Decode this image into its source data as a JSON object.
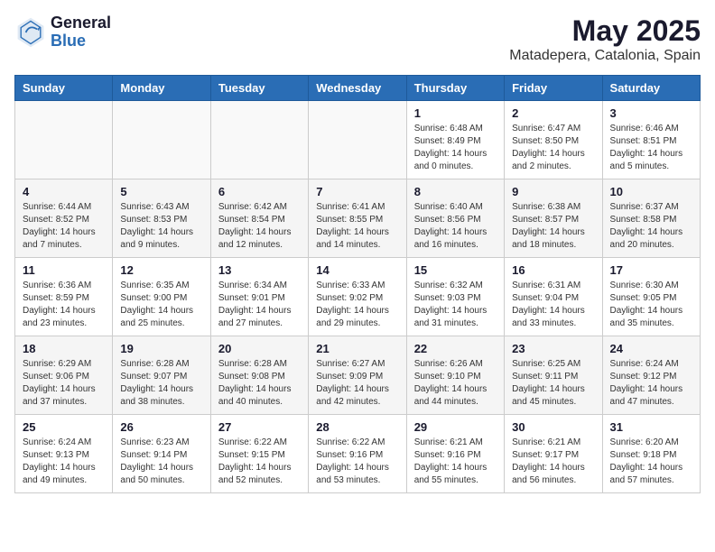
{
  "logo": {
    "general": "General",
    "blue": "Blue"
  },
  "title": "May 2025",
  "subtitle": "Matadepera, Catalonia, Spain",
  "days_header": [
    "Sunday",
    "Monday",
    "Tuesday",
    "Wednesday",
    "Thursday",
    "Friday",
    "Saturday"
  ],
  "weeks": [
    [
      {
        "day": "",
        "info": ""
      },
      {
        "day": "",
        "info": ""
      },
      {
        "day": "",
        "info": ""
      },
      {
        "day": "",
        "info": ""
      },
      {
        "day": "1",
        "info": "Sunrise: 6:48 AM\nSunset: 8:49 PM\nDaylight: 14 hours and 0 minutes."
      },
      {
        "day": "2",
        "info": "Sunrise: 6:47 AM\nSunset: 8:50 PM\nDaylight: 14 hours and 2 minutes."
      },
      {
        "day": "3",
        "info": "Sunrise: 6:46 AM\nSunset: 8:51 PM\nDaylight: 14 hours and 5 minutes."
      }
    ],
    [
      {
        "day": "4",
        "info": "Sunrise: 6:44 AM\nSunset: 8:52 PM\nDaylight: 14 hours and 7 minutes."
      },
      {
        "day": "5",
        "info": "Sunrise: 6:43 AM\nSunset: 8:53 PM\nDaylight: 14 hours and 9 minutes."
      },
      {
        "day": "6",
        "info": "Sunrise: 6:42 AM\nSunset: 8:54 PM\nDaylight: 14 hours and 12 minutes."
      },
      {
        "day": "7",
        "info": "Sunrise: 6:41 AM\nSunset: 8:55 PM\nDaylight: 14 hours and 14 minutes."
      },
      {
        "day": "8",
        "info": "Sunrise: 6:40 AM\nSunset: 8:56 PM\nDaylight: 14 hours and 16 minutes."
      },
      {
        "day": "9",
        "info": "Sunrise: 6:38 AM\nSunset: 8:57 PM\nDaylight: 14 hours and 18 minutes."
      },
      {
        "day": "10",
        "info": "Sunrise: 6:37 AM\nSunset: 8:58 PM\nDaylight: 14 hours and 20 minutes."
      }
    ],
    [
      {
        "day": "11",
        "info": "Sunrise: 6:36 AM\nSunset: 8:59 PM\nDaylight: 14 hours and 23 minutes."
      },
      {
        "day": "12",
        "info": "Sunrise: 6:35 AM\nSunset: 9:00 PM\nDaylight: 14 hours and 25 minutes."
      },
      {
        "day": "13",
        "info": "Sunrise: 6:34 AM\nSunset: 9:01 PM\nDaylight: 14 hours and 27 minutes."
      },
      {
        "day": "14",
        "info": "Sunrise: 6:33 AM\nSunset: 9:02 PM\nDaylight: 14 hours and 29 minutes."
      },
      {
        "day": "15",
        "info": "Sunrise: 6:32 AM\nSunset: 9:03 PM\nDaylight: 14 hours and 31 minutes."
      },
      {
        "day": "16",
        "info": "Sunrise: 6:31 AM\nSunset: 9:04 PM\nDaylight: 14 hours and 33 minutes."
      },
      {
        "day": "17",
        "info": "Sunrise: 6:30 AM\nSunset: 9:05 PM\nDaylight: 14 hours and 35 minutes."
      }
    ],
    [
      {
        "day": "18",
        "info": "Sunrise: 6:29 AM\nSunset: 9:06 PM\nDaylight: 14 hours and 37 minutes."
      },
      {
        "day": "19",
        "info": "Sunrise: 6:28 AM\nSunset: 9:07 PM\nDaylight: 14 hours and 38 minutes."
      },
      {
        "day": "20",
        "info": "Sunrise: 6:28 AM\nSunset: 9:08 PM\nDaylight: 14 hours and 40 minutes."
      },
      {
        "day": "21",
        "info": "Sunrise: 6:27 AM\nSunset: 9:09 PM\nDaylight: 14 hours and 42 minutes."
      },
      {
        "day": "22",
        "info": "Sunrise: 6:26 AM\nSunset: 9:10 PM\nDaylight: 14 hours and 44 minutes."
      },
      {
        "day": "23",
        "info": "Sunrise: 6:25 AM\nSunset: 9:11 PM\nDaylight: 14 hours and 45 minutes."
      },
      {
        "day": "24",
        "info": "Sunrise: 6:24 AM\nSunset: 9:12 PM\nDaylight: 14 hours and 47 minutes."
      }
    ],
    [
      {
        "day": "25",
        "info": "Sunrise: 6:24 AM\nSunset: 9:13 PM\nDaylight: 14 hours and 49 minutes."
      },
      {
        "day": "26",
        "info": "Sunrise: 6:23 AM\nSunset: 9:14 PM\nDaylight: 14 hours and 50 minutes."
      },
      {
        "day": "27",
        "info": "Sunrise: 6:22 AM\nSunset: 9:15 PM\nDaylight: 14 hours and 52 minutes."
      },
      {
        "day": "28",
        "info": "Sunrise: 6:22 AM\nSunset: 9:16 PM\nDaylight: 14 hours and 53 minutes."
      },
      {
        "day": "29",
        "info": "Sunrise: 6:21 AM\nSunset: 9:16 PM\nDaylight: 14 hours and 55 minutes."
      },
      {
        "day": "30",
        "info": "Sunrise: 6:21 AM\nSunset: 9:17 PM\nDaylight: 14 hours and 56 minutes."
      },
      {
        "day": "31",
        "info": "Sunrise: 6:20 AM\nSunset: 9:18 PM\nDaylight: 14 hours and 57 minutes."
      }
    ]
  ]
}
